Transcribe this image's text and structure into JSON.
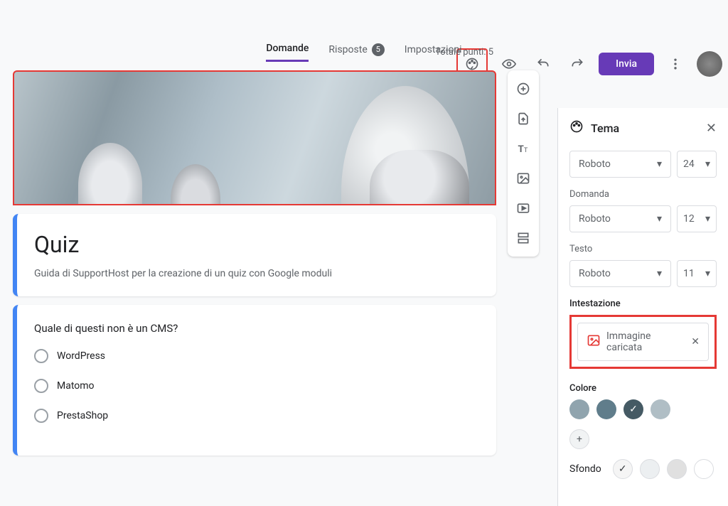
{
  "header": {
    "send_label": "Invia"
  },
  "tabs": {
    "questions": "Domande",
    "responses": "Risposte",
    "responses_count": "5",
    "settings": "Impostazioni",
    "total_points": "Totale punti: 5"
  },
  "form": {
    "title": "Quiz",
    "description": "Guida di SupportHost per la creazione di un quiz con Google moduli",
    "question": "Quale di questi non è un CMS?",
    "options": [
      "WordPress",
      "Matomo",
      "PrestaShop"
    ]
  },
  "theme": {
    "panel_title": "Tema",
    "header_font": "Roboto",
    "header_size": "24",
    "question_label": "Domanda",
    "question_font": "Roboto",
    "question_size": "12",
    "text_label": "Testo",
    "text_font": "Roboto",
    "text_size": "11",
    "header_section": "Intestazione",
    "image_chip": "Immagine caricata",
    "color_label": "Colore",
    "colors": [
      "#90a4ae",
      "#607d8b",
      "#455a64",
      "#b0bec5"
    ],
    "selected_color_index": 2,
    "bg_label": "Sfondo",
    "bg_colors": [
      "#f5f5f5",
      "#eceff1",
      "#e0e0e0",
      "#ffffff"
    ],
    "bg_selected_index": 0
  }
}
